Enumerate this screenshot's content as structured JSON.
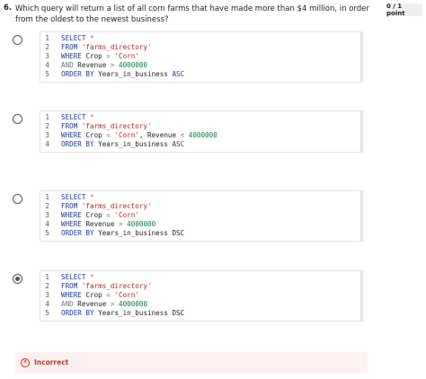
{
  "question": {
    "number": "6.",
    "text": "Which query will return a list of all corn farms that have made more than $4 million, in order from the oldest to the newest business?",
    "points": "0 / 1 point"
  },
  "options": [
    {
      "selected": false,
      "lines": [
        {
          "n": "1",
          "tokens": [
            {
              "t": "SELECT",
              "c": "kw"
            },
            {
              "t": " *",
              "c": "op"
            }
          ]
        },
        {
          "n": "2",
          "tokens": [
            {
              "t": "FROM ",
              "c": "kw"
            },
            {
              "t": "'farms_directory'",
              "c": "str"
            }
          ]
        },
        {
          "n": "3",
          "tokens": [
            {
              "t": "WHERE ",
              "c": "kw"
            },
            {
              "t": "Crop ",
              "c": "plain"
            },
            {
              "t": "= ",
              "c": "op"
            },
            {
              "t": "'Corn'",
              "c": "str"
            }
          ]
        },
        {
          "n": "4",
          "tokens": [
            {
              "t": "AND ",
              "c": "op"
            },
            {
              "t": "Revenue ",
              "c": "plain"
            },
            {
              "t": "> ",
              "c": "op"
            },
            {
              "t": "4000000",
              "c": "num"
            }
          ]
        },
        {
          "n": "5",
          "tokens": [
            {
              "t": "ORDER BY ",
              "c": "kw"
            },
            {
              "t": "Years_in_business ",
              "c": "plain"
            },
            {
              "t": "ASC",
              "c": "kw"
            }
          ]
        }
      ]
    },
    {
      "selected": false,
      "lines": [
        {
          "n": "1",
          "tokens": [
            {
              "t": "SELECT",
              "c": "kw"
            },
            {
              "t": " *",
              "c": "op"
            }
          ]
        },
        {
          "n": "2",
          "tokens": [
            {
              "t": "FROM ",
              "c": "kw"
            },
            {
              "t": "'farms_directory'",
              "c": "str"
            }
          ]
        },
        {
          "n": "3",
          "tokens": [
            {
              "t": "WHERE ",
              "c": "kw"
            },
            {
              "t": "Crop ",
              "c": "plain"
            },
            {
              "t": "= ",
              "c": "op"
            },
            {
              "t": "'Corn'",
              "c": "str"
            },
            {
              "t": ", Revenue ",
              "c": "plain"
            },
            {
              "t": "< ",
              "c": "op"
            },
            {
              "t": "4000000",
              "c": "num"
            }
          ]
        },
        {
          "n": "4",
          "tokens": [
            {
              "t": "ORDER BY ",
              "c": "kw"
            },
            {
              "t": "Years_in_business ",
              "c": "plain"
            },
            {
              "t": "ASC",
              "c": "kw"
            }
          ]
        }
      ]
    },
    {
      "selected": false,
      "lines": [
        {
          "n": "1",
          "tokens": [
            {
              "t": "SELECT",
              "c": "kw"
            },
            {
              "t": " *",
              "c": "op"
            }
          ]
        },
        {
          "n": "2",
          "tokens": [
            {
              "t": "FROM ",
              "c": "kw"
            },
            {
              "t": "'farms_directory'",
              "c": "str"
            }
          ]
        },
        {
          "n": "3",
          "tokens": [
            {
              "t": "WHERE ",
              "c": "kw"
            },
            {
              "t": "Crop ",
              "c": "plain"
            },
            {
              "t": "= ",
              "c": "op"
            },
            {
              "t": "'Corn'",
              "c": "str"
            }
          ]
        },
        {
          "n": "4",
          "tokens": [
            {
              "t": "WHERE ",
              "c": "kw"
            },
            {
              "t": "Revenue ",
              "c": "plain"
            },
            {
              "t": "> ",
              "c": "op"
            },
            {
              "t": "4000000",
              "c": "num"
            }
          ]
        },
        {
          "n": "5",
          "tokens": [
            {
              "t": "ORDER BY ",
              "c": "kw"
            },
            {
              "t": "Years_in_business DSC",
              "c": "plain"
            }
          ]
        }
      ]
    },
    {
      "selected": true,
      "lines": [
        {
          "n": "1",
          "tokens": [
            {
              "t": "SELECT",
              "c": "kw"
            },
            {
              "t": " *",
              "c": "op"
            }
          ]
        },
        {
          "n": "2",
          "tokens": [
            {
              "t": "FROM ",
              "c": "kw"
            },
            {
              "t": "'farms_directory'",
              "c": "str"
            }
          ]
        },
        {
          "n": "3",
          "tokens": [
            {
              "t": "WHERE ",
              "c": "kw"
            },
            {
              "t": "Crop ",
              "c": "plain"
            },
            {
              "t": "= ",
              "c": "op"
            },
            {
              "t": "'Corn'",
              "c": "str"
            }
          ]
        },
        {
          "n": "4",
          "tokens": [
            {
              "t": "AND ",
              "c": "op"
            },
            {
              "t": "Revenue ",
              "c": "plain"
            },
            {
              "t": "> ",
              "c": "op"
            },
            {
              "t": "4000000",
              "c": "num"
            }
          ]
        },
        {
          "n": "5",
          "tokens": [
            {
              "t": "ORDER BY ",
              "c": "kw"
            },
            {
              "t": "Years_in_business DSC",
              "c": "plain"
            }
          ]
        }
      ]
    }
  ],
  "feedback": {
    "label": "Incorrect",
    "icon": "x-circle-icon",
    "color": "#c0392b"
  }
}
